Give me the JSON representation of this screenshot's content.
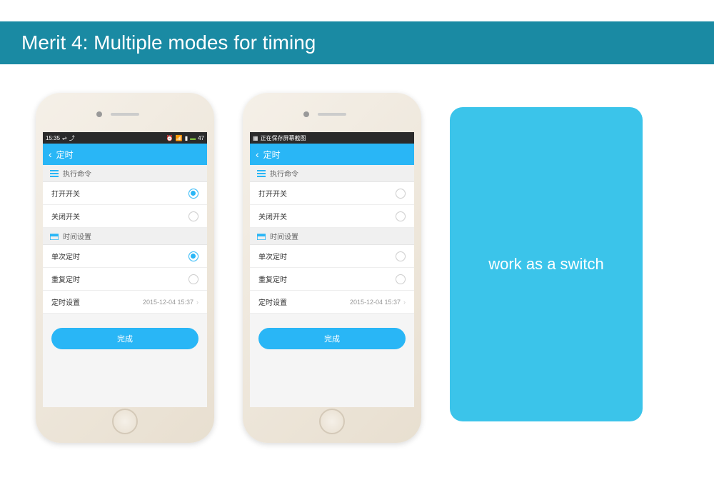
{
  "header": {
    "title": "Merit 4: Multiple modes for timing"
  },
  "phone1": {
    "status_time": "15:35",
    "status_battery": "47",
    "app_title": "定时",
    "section1_label": "执行命令",
    "item_open": "打开开关",
    "item_close": "关闭开关",
    "section2_label": "时间设置",
    "item_single": "单次定时",
    "item_repeat": "重复定时",
    "item_time_label": "定时设置",
    "item_time_value": "2015-12-04 15:37",
    "done": "完成",
    "radio_open_selected": true,
    "radio_close_selected": false,
    "radio_single_selected": true,
    "radio_repeat_selected": false
  },
  "phone2": {
    "status_text": "正在保存屏幕截图",
    "app_title": "定时",
    "section1_label": "执行命令",
    "item_open": "打开开关",
    "item_close": "关闭开关",
    "section2_label": "时间设置",
    "item_single": "单次定时",
    "item_repeat": "重复定时",
    "item_time_label": "定时设置",
    "item_time_value": "2015-12-04 15:37",
    "done": "完成",
    "radio_open_selected": false,
    "radio_close_selected": false,
    "radio_single_selected": false,
    "radio_repeat_selected": false
  },
  "switch_card": {
    "text": "work as a switch"
  }
}
